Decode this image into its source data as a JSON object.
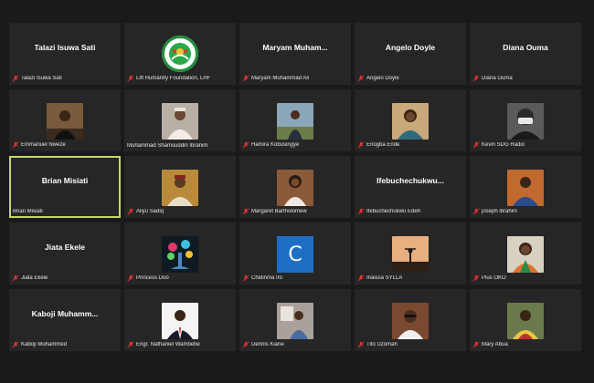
{
  "participants": [
    {
      "display": "Talazi Isuwa Sati",
      "label": "Talazi Isuwa Sati",
      "muted": true
    },
    {
      "display": "",
      "label": "Lift Humanity Foundation, LHF",
      "muted": true,
      "logo": true,
      "logo_text": "LIFT HUMANITY FOUNDATION"
    },
    {
      "display": "Maryam Muham...",
      "label": "Maryam Muhammad Ali",
      "muted": true
    },
    {
      "display": "Angelo Doyle",
      "label": "Angelo Doyle",
      "muted": true
    },
    {
      "display": "Diana Ouma",
      "label": "Diana Ouma",
      "muted": true
    },
    {
      "display": "",
      "label": "Emmanuel Nweze",
      "muted": true,
      "photo": "p1"
    },
    {
      "display": "",
      "label": "Muhammad Shamsuddin Ibrahim",
      "muted": false,
      "photo": "p2"
    },
    {
      "display": "",
      "label": "Hamira Kobusingye",
      "muted": true,
      "photo": "p3"
    },
    {
      "display": "",
      "label": "Enogba Ende",
      "muted": true,
      "photo": "p4"
    },
    {
      "display": "",
      "label": "Kevin SDG Radio",
      "muted": true,
      "photo": "p5"
    },
    {
      "display": "Brian Misiati",
      "label": "Brian Misiati",
      "muted": false,
      "active": true
    },
    {
      "display": "",
      "label": "Aliyu Sadiq",
      "muted": true,
      "photo": "p6"
    },
    {
      "display": "",
      "label": "Margaret Bartholomew",
      "muted": true,
      "photo": "p7"
    },
    {
      "display": "Ifebuchechukwu...",
      "label": "Ifebuchechukwu Edeh",
      "muted": true
    },
    {
      "display": "",
      "label": "joseph ibrahim",
      "muted": true,
      "photo": "p8"
    },
    {
      "display": "Jiata Ekele",
      "label": "Jiata Ekele",
      "muted": true
    },
    {
      "display": "",
      "label": "Princess Doo",
      "muted": true,
      "photo": "p9"
    },
    {
      "display": "",
      "label": "Chidinma Iro",
      "muted": true,
      "letter": "C"
    },
    {
      "display": "",
      "label": "Inaissa SYLLA",
      "muted": true,
      "photo": "p10"
    },
    {
      "display": "",
      "label": "Pius OKO",
      "muted": true,
      "photo": "p11"
    },
    {
      "display": "Kaboji Muhamm...",
      "label": "Kaboji Muhammed",
      "muted": true
    },
    {
      "display": "",
      "label": "Engr. Nathaniel Wambebe",
      "muted": true,
      "photo": "p12"
    },
    {
      "display": "",
      "label": "Dennis Kiarie",
      "muted": true,
      "photo": "p13"
    },
    {
      "display": "",
      "label": "Tito Uzomah",
      "muted": true,
      "photo": "p14"
    },
    {
      "display": "",
      "label": "Mary Abua",
      "muted": true,
      "photo": "p15"
    }
  ],
  "colors": {
    "background": "#1a1a1a",
    "tile": "#262626",
    "active_border": "#c6d66b",
    "muted_icon": "#e0342f",
    "letter_tile": "#1e6fc4"
  }
}
